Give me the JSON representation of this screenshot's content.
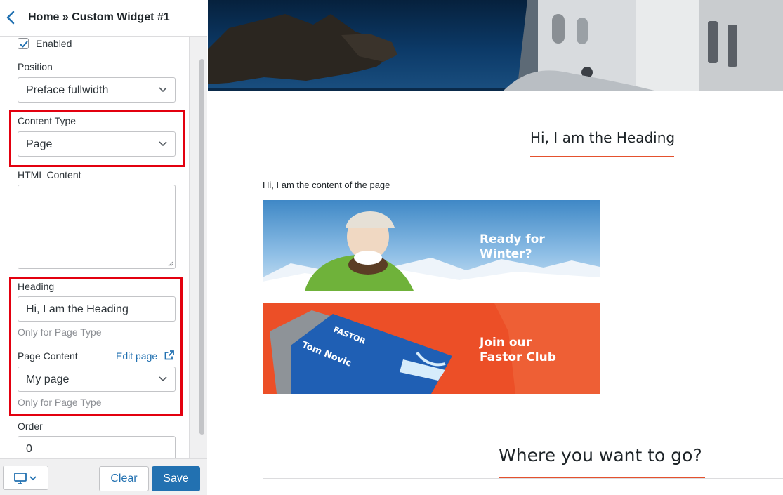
{
  "panel": {
    "breadcrumb": "Home » Custom Widget #1",
    "enabled_label": "Enabled",
    "enabled_checked": true,
    "position": {
      "label": "Position",
      "value": "Preface fullwidth"
    },
    "content_type": {
      "label": "Content Type",
      "value": "Page"
    },
    "html_content": {
      "label": "HTML Content",
      "value": ""
    },
    "heading": {
      "label": "Heading",
      "value": "Hi, I am the Heading",
      "hint": "Only for Page Type"
    },
    "page_content": {
      "label": "Page Content",
      "edit_link": "Edit page",
      "value": "My page",
      "hint": "Only for Page Type"
    },
    "order": {
      "label": "Order",
      "value": "0"
    }
  },
  "footer": {
    "clear_label": "Clear",
    "save_label": "Save",
    "device_icon": "desktop-icon"
  },
  "preview": {
    "heading": "Hi, I am the Heading",
    "content_text": "Hi, I am the content of the page",
    "banner1": {
      "line1": "Ready for",
      "line2": "Winter?"
    },
    "banner2": {
      "line1": "Join our",
      "line2": "Fastor Club",
      "card_brand": "FASTOR",
      "card_name": "Tom Novic"
    },
    "section_title": "Where you want to go?"
  },
  "colors": {
    "accent": "#2271b1",
    "highlight": "#e3000f",
    "brand_orange": "#ec4f27",
    "heading_underline": "#e4512e"
  }
}
